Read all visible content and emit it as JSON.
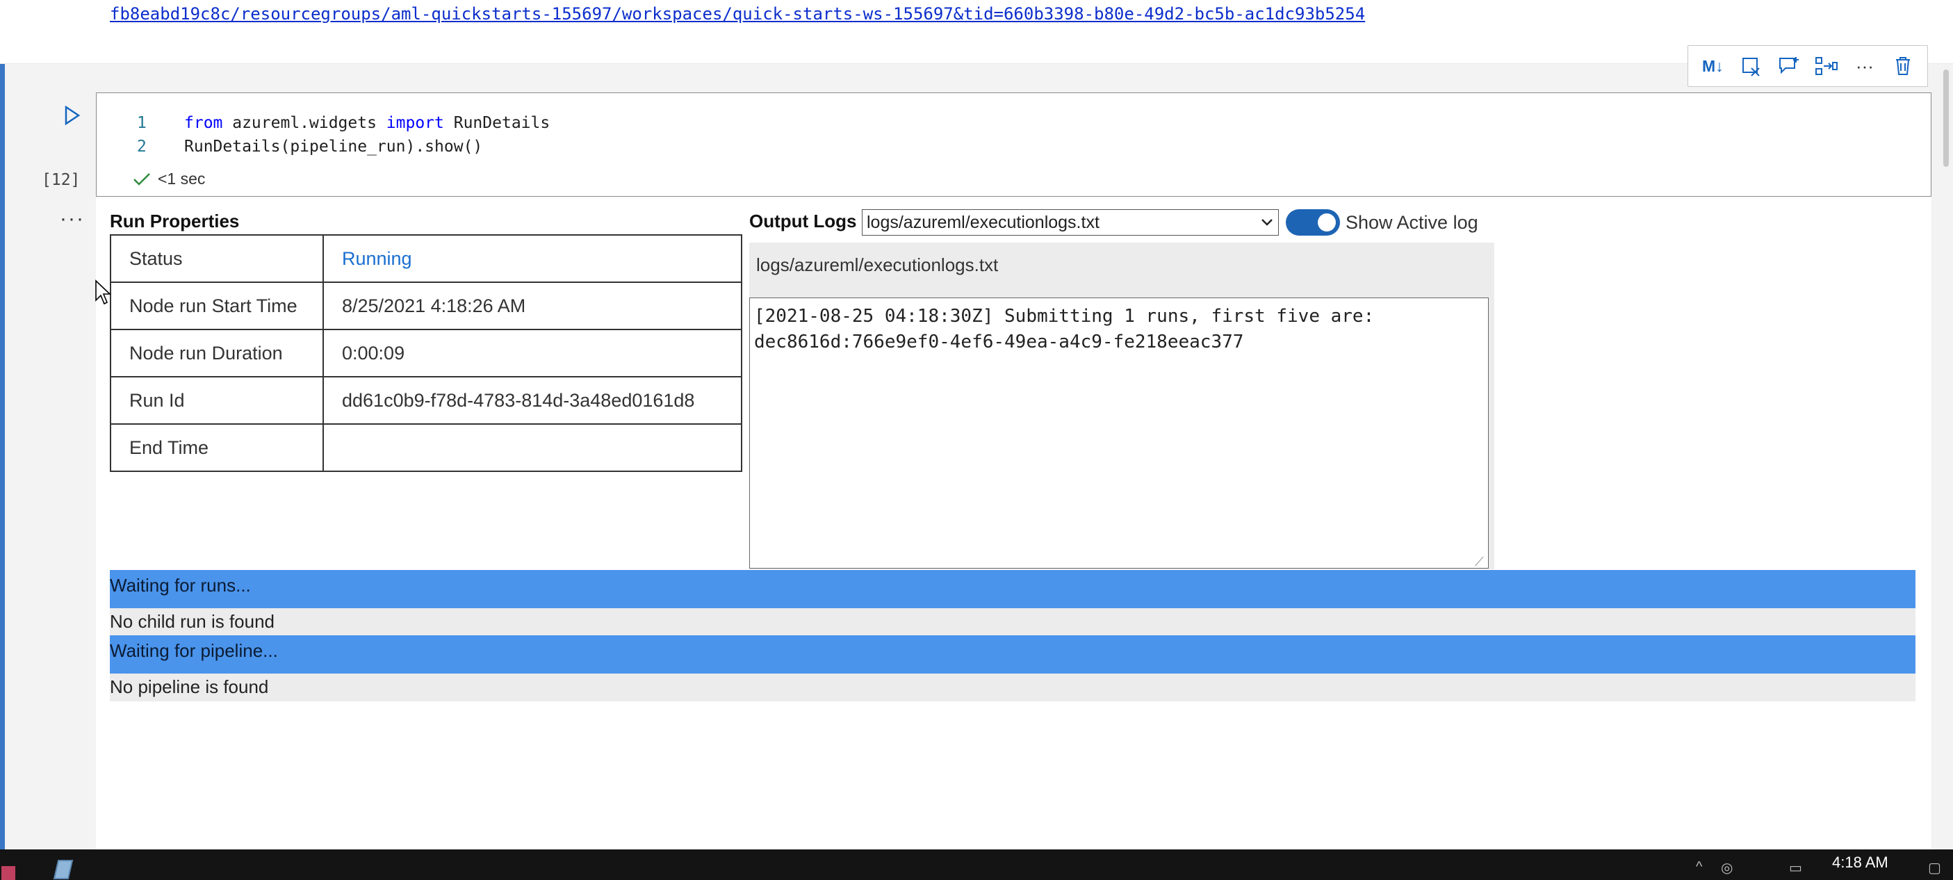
{
  "top": {
    "link_text": "fb8eabd19c8c/resourcegroups/aml-quickstarts-155697/workspaces/quick-starts-ws-155697&tid=660b3398-b80e-49d2-bc5b-ac1dc93b5254"
  },
  "toolbar": {
    "icons": [
      "markdown-toggle-icon",
      "clear-output-icon",
      "add-comment-icon",
      "split-cell-icon",
      "more-icon",
      "delete-icon"
    ],
    "markdown_label": "M↓"
  },
  "cell": {
    "execution_count": "[12]",
    "lines": [
      {
        "no": "1",
        "kw1": "from",
        "mod": " azureml.widgets ",
        "kw2": "import",
        "rest": " RunDetails"
      },
      {
        "no": "2",
        "text": "RunDetails(pipeline_run).show()"
      }
    ],
    "exec_time": "<1 sec",
    "more_label": "···"
  },
  "run_properties": {
    "title": "Run Properties",
    "rows": [
      {
        "key": "Status",
        "value": "Running"
      },
      {
        "key": "Node run Start Time",
        "value": "8/25/2021 4:18:26 AM"
      },
      {
        "key": "Node run Duration",
        "value": "0:00:09"
      },
      {
        "key": "Run Id",
        "value": "dd61c0b9-f78d-4783-814d-3a48ed0161d8"
      },
      {
        "key": "End Time",
        "value": ""
      }
    ]
  },
  "output_logs": {
    "title": "Output Logs",
    "selected_log": "logs/azureml/executionlogs.txt",
    "toggle_label": "Show Active log",
    "toggle_on": true,
    "filename": "logs/azureml/executionlogs.txt",
    "content": "[2021-08-25 04:18:30Z] Submitting 1 runs, first five are: dec8616d:766e9ef0-4ef6-49ea-a4c9-fe218eeac377"
  },
  "status": {
    "runs_banner": "Waiting for runs...",
    "runs_message": "No child run is found",
    "pipeline_banner": "Waiting for pipeline...",
    "pipeline_message": "No pipeline is found"
  },
  "taskbar": {
    "time": "4:18 AM"
  },
  "colors": {
    "accent": "#3a76c4",
    "banner": "#4a94ec",
    "status_running": "#1a6fd0",
    "toggle": "#1e64b4",
    "keyword": "#0000ff"
  }
}
